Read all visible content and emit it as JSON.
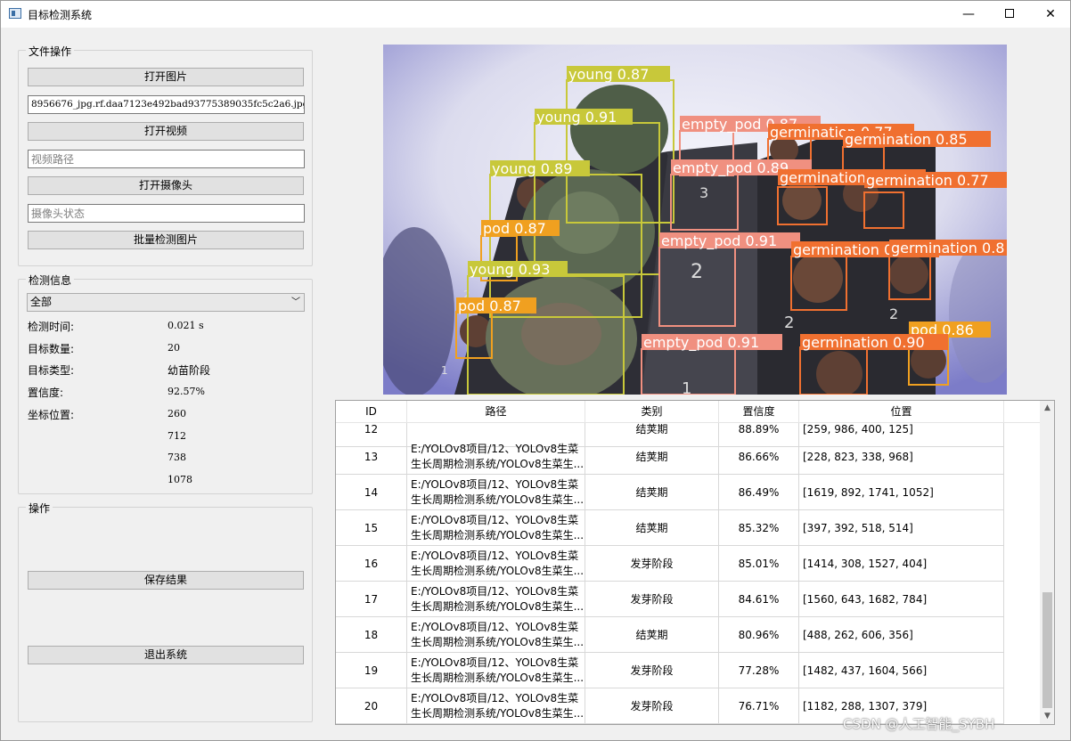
{
  "window": {
    "title": "目标检测系统",
    "min_glyph": "—",
    "close_glyph": "✕"
  },
  "file_ops": {
    "title": "文件操作",
    "open_image": "打开图片",
    "image_path": "8956676_jpg.rf.daa7123e492bad93775389035fc5c2a6.jpg",
    "open_video": "打开视频",
    "video_placeholder": "视频路径",
    "open_camera": "打开摄像头",
    "camera_placeholder": "摄像头状态",
    "batch_detect": "批量检测图片"
  },
  "detect_info": {
    "title": "检测信息",
    "filter_selected": "全部",
    "time_label": "检测时间:",
    "time_value": "0.021 s",
    "count_label": "目标数量:",
    "count_value": "20",
    "type_label": "目标类型:",
    "type_value": "幼苗阶段",
    "conf_label": "置信度:",
    "conf_value": "92.57%",
    "pos_label": "坐标位置:",
    "pos_values": [
      "260",
      "712",
      "738",
      "1078"
    ]
  },
  "ops": {
    "title": "操作",
    "save": "保存结果",
    "exit": "退出系统"
  },
  "preview": {
    "boxes": [
      {
        "label": "young 0.87",
        "color": "#c8c83a"
      },
      {
        "label": "young 0.91",
        "color": "#c8c83a"
      },
      {
        "label": "young 0.89",
        "color": "#c8c83a"
      },
      {
        "label": "young 0.93",
        "color": "#c8c83a"
      },
      {
        "label": "pod 0.87",
        "color": "#f0a020"
      },
      {
        "label": "pod 0.87",
        "color": "#f0a020"
      },
      {
        "label": "pod 0.86",
        "color": "#f0a020"
      },
      {
        "label": "empty_pod 0.87",
        "color": "#f09080"
      },
      {
        "label": "empty_pod 0.89",
        "color": "#f09080"
      },
      {
        "label": "empty_pod 0.91",
        "color": "#f09080"
      },
      {
        "label": "empty_pod 0.91",
        "color": "#f09080"
      },
      {
        "label": "germination 0.77",
        "color": "#f07030"
      },
      {
        "label": "germination 0.85",
        "color": "#f07030"
      },
      {
        "label": "germination 0.91",
        "color": "#f07030"
      },
      {
        "label": "germination 0.77",
        "color": "#f07030"
      },
      {
        "label": "germination 0.89",
        "color": "#f07030"
      },
      {
        "label": "germination 0.8",
        "color": "#f07030"
      },
      {
        "label": "germination 0.90",
        "color": "#f07030"
      }
    ],
    "pod_numbers": [
      "3",
      "2",
      "1",
      "2",
      "2",
      "1",
      "2"
    ]
  },
  "table": {
    "headers": [
      "ID",
      "路径",
      "类别",
      "置信度",
      "位置"
    ],
    "partial_row": {
      "id": "12",
      "class": "结荚期",
      "conf": "88.89%",
      "pos": "[259, 986, 400, 125]"
    },
    "rows": [
      {
        "id": "13",
        "path1": "E:/YOLOv8项目/12、YOLOv8生菜",
        "path2": "生长周期检测系统/YOLOv8生菜生...",
        "class": "结荚期",
        "conf": "86.66%",
        "pos": "[228, 823, 338, 968]"
      },
      {
        "id": "14",
        "path1": "E:/YOLOv8项目/12、YOLOv8生菜",
        "path2": "生长周期检测系统/YOLOv8生菜生...",
        "class": "结荚期",
        "conf": "86.49%",
        "pos": "[1619, 892, 1741, 1052]"
      },
      {
        "id": "15",
        "path1": "E:/YOLOv8项目/12、YOLOv8生菜",
        "path2": "生长周期检测系统/YOLOv8生菜生...",
        "class": "结荚期",
        "conf": "85.32%",
        "pos": "[397, 392, 518, 514]"
      },
      {
        "id": "16",
        "path1": "E:/YOLOv8项目/12、YOLOv8生菜",
        "path2": "生长周期检测系统/YOLOv8生菜生...",
        "class": "发芽阶段",
        "conf": "85.01%",
        "pos": "[1414, 308, 1527, 404]"
      },
      {
        "id": "17",
        "path1": "E:/YOLOv8项目/12、YOLOv8生菜",
        "path2": "生长周期检测系统/YOLOv8生菜生...",
        "class": "发芽阶段",
        "conf": "84.61%",
        "pos": "[1560, 643, 1682, 784]"
      },
      {
        "id": "18",
        "path1": "E:/YOLOv8项目/12、YOLOv8生菜",
        "path2": "生长周期检测系统/YOLOv8生菜生...",
        "class": "结荚期",
        "conf": "80.96%",
        "pos": "[488, 262, 606, 356]"
      },
      {
        "id": "19",
        "path1": "E:/YOLOv8项目/12、YOLOv8生菜",
        "path2": "生长周期检测系统/YOLOv8生菜生...",
        "class": "发芽阶段",
        "conf": "77.28%",
        "pos": "[1482, 437, 1604, 566]"
      },
      {
        "id": "20",
        "path1": "E:/YOLOv8项目/12、YOLOv8生菜",
        "path2": "生长周期检测系统/YOLOv8生菜生...",
        "class": "发芽阶段",
        "conf": "76.71%",
        "pos": "[1182, 288, 1307, 379]"
      }
    ]
  },
  "watermark": "CSDN @人工智能_SYBH"
}
